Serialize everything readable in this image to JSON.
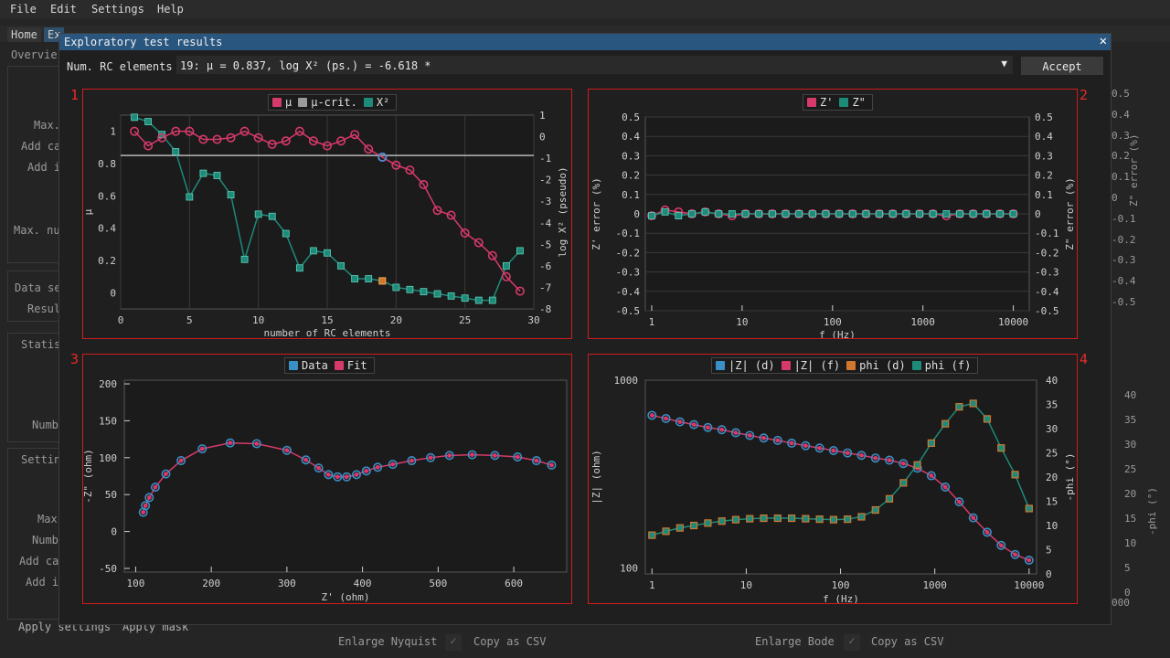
{
  "menu": [
    "File",
    "Edit",
    "Settings",
    "Help"
  ],
  "bg_tabs": [
    "Home",
    "Ex"
  ],
  "bg_left": {
    "overview": "Overvie",
    "max": "Max.",
    "add_ca": "Add ca",
    "add_i": "Add i",
    "max_nu": "Max. nu",
    "data_se": "Data se",
    "resul": "Resul",
    "statis": "Statis",
    "numb": "Numb",
    "settin": "Settin",
    "max2": "Max",
    "numb2": "Numb",
    "add_ca2": "Add ca",
    "add_i2": "Add i",
    "apply_settings": "Apply settings",
    "apply_mask": "Apply mask"
  },
  "bg_right_ticks": [
    "0.5",
    "0.4",
    "0.3",
    "0.2",
    "0.1",
    "0",
    "-0.1",
    "-0.2",
    "-0.3",
    "-0.4",
    "-0.5"
  ],
  "bg_right_label": "Z\" error (%)",
  "bg_right_ticks2": [
    "40",
    "35",
    "30",
    "25",
    "20",
    "15",
    "10",
    "5",
    "0"
  ],
  "bg_right_label2": "-phi (°)",
  "bg_right_bottom": "000",
  "bottom": {
    "enlarge_nyquist": "Enlarge Nyquist",
    "copy_csv_1": "Copy as CSV",
    "enlarge_bode": "Enlarge Bode",
    "copy_csv_2": "Copy as CSV",
    "check": "✓"
  },
  "modal": {
    "title": "Exploratory test results",
    "close": "✕",
    "rc_label": "Num. RC elements",
    "rc_value": "19: μ = 0.837, log X² (ps.) = -6.618 *",
    "arrow": "▼",
    "accept": "Accept"
  },
  "colors": {
    "mu": "#d63a6a",
    "crit": "#9a9a9a",
    "x2": "#1e8a7a",
    "data": "#3a8fc4",
    "fit": "#d63a6a",
    "phi_d": "#d0782e",
    "phi_f": "#1e8a7a",
    "highlight": "#4d8fd6",
    "frame": "#d01c1c"
  },
  "plots": [
    {
      "number": "1",
      "legend": [
        "μ",
        "μ-crit.",
        "X²"
      ],
      "chart_data": {
        "type": "line",
        "xlabel": "number of RC elements",
        "ylabel": "μ",
        "y2label": "log X² (pseudo)",
        "xlim": [
          0,
          30
        ],
        "ylim": [
          -0.1,
          1.1
        ],
        "y2lim": [
          -8,
          1
        ],
        "xticks": [
          "0",
          "5",
          "10",
          "15",
          "20",
          "25",
          "30"
        ],
        "yticks": [
          "0",
          "0.2",
          "0.4",
          "0.6",
          "0.8",
          "1"
        ],
        "y2ticks": [
          "1",
          "0",
          "-1",
          "-2",
          "-3",
          "-4",
          "-5",
          "-6",
          "-7",
          "-8"
        ],
        "mu_crit": 0.85,
        "selected": 19,
        "series": [
          {
            "name": "μ",
            "x": [
              1,
              2,
              3,
              4,
              5,
              6,
              7,
              8,
              9,
              10,
              11,
              12,
              13,
              14,
              15,
              16,
              17,
              18,
              19,
              20,
              21,
              22,
              23,
              24,
              25,
              26,
              27,
              28,
              29
            ],
            "values": [
              1.0,
              0.91,
              0.96,
              1.0,
              1.0,
              0.95,
              0.95,
              0.96,
              1.0,
              0.96,
              0.92,
              0.94,
              1.0,
              0.94,
              0.91,
              0.94,
              0.98,
              0.89,
              0.84,
              0.79,
              0.76,
              0.67,
              0.51,
              0.48,
              0.37,
              0.31,
              0.23,
              0.1,
              0.01
            ]
          },
          {
            "name": "X²",
            "x": [
              1,
              2,
              3,
              4,
              5,
              6,
              7,
              8,
              9,
              10,
              11,
              12,
              13,
              14,
              15,
              16,
              17,
              18,
              19,
              20,
              21,
              22,
              23,
              24,
              25,
              26,
              27,
              28,
              29
            ],
            "values": [
              0.9,
              0.7,
              0.1,
              -0.7,
              -2.8,
              -1.7,
              -1.8,
              -2.7,
              -5.7,
              -3.6,
              -3.7,
              -4.5,
              -6.1,
              -5.3,
              -5.4,
              -6.0,
              -6.6,
              -6.6,
              -6.7,
              -7.0,
              -7.1,
              -7.2,
              -7.3,
              -7.4,
              -7.5,
              -7.6,
              -7.6,
              -6.0,
              -5.3
            ]
          }
        ]
      }
    },
    {
      "number": "2",
      "legend": [
        "Z'",
        "Z\""
      ],
      "chart_data": {
        "type": "line",
        "xlabel": "f (Hz)",
        "ylabel": "Z' error (%)",
        "y2label": "Z\" error (%)",
        "xscale": "log",
        "xlim": [
          1,
          10000
        ],
        "ylim": [
          -0.5,
          0.5
        ],
        "xticks": [
          "1",
          "10",
          "100",
          "1000",
          "10000"
        ],
        "yticks": [
          "0.5",
          "0.4",
          "0.3",
          "0.2",
          "0.1",
          "0",
          "-0.1",
          "-0.2",
          "-0.3",
          "-0.4",
          "-0.5"
        ],
        "series": [
          {
            "name": "Z'",
            "values": [
              -0.01,
              0.02,
              0.01,
              0.0,
              0.01,
              0.0,
              -0.01,
              0.0,
              0.0,
              0.0,
              0.0,
              0.0,
              0.0,
              0.0,
              0.0,
              0.0,
              0.0,
              0.0,
              0.0,
              0.0,
              0.0,
              0.0,
              -0.01,
              0.0,
              0.0,
              0.0,
              0.0,
              0.0
            ]
          },
          {
            "name": "Z\"",
            "values": [
              -0.01,
              0.01,
              -0.01,
              0.0,
              0.01,
              0.0,
              0.0,
              0.0,
              0.0,
              0.0,
              0.0,
              0.0,
              0.0,
              0.0,
              0.0,
              0.0,
              0.0,
              0.0,
              0.0,
              0.0,
              0.0,
              0.0,
              0.0,
              0.0,
              0.0,
              0.0,
              0.0,
              0.0
            ]
          }
        ]
      }
    },
    {
      "number": "3",
      "legend": [
        "Data",
        "Fit"
      ],
      "chart_data": {
        "type": "scatter",
        "xlabel": "Z' (ohm)",
        "ylabel": "-Z\" (ohm)",
        "xlim": [
          85,
          670
        ],
        "ylim": [
          -55,
          205
        ],
        "xticks": [
          "100",
          "200",
          "300",
          "400",
          "500",
          "600"
        ],
        "yticks": [
          "200",
          "150",
          "100",
          "50",
          "0",
          "-50"
        ],
        "series": [
          {
            "name": "Data",
            "x": [
              110,
              113,
              118,
              126,
              140,
              160,
              188,
              225,
              260,
              300,
              325,
              342,
              355,
              367,
              379,
              392,
              405,
              420,
              440,
              465,
              490,
              515,
              545,
              575,
              605,
              630,
              650
            ],
            "values": [
              26,
              35,
              46,
              60,
              78,
              96,
              112,
              120,
              119,
              110,
              97,
              86,
              77,
              74,
              74,
              77,
              82,
              87,
              91,
              96,
              100,
              103,
              104,
              103,
              101,
              96,
              90
            ]
          }
        ]
      }
    },
    {
      "number": "4",
      "legend": [
        "|Z| (d)",
        "|Z| (f)",
        "phi (d)",
        "phi (f)"
      ],
      "chart_data": {
        "type": "line",
        "xlabel": "f (Hz)",
        "ylabel": "|Z| (ohm)",
        "y2label": "-phi (°)",
        "xscale": "log",
        "yscale": "log",
        "xlim": [
          0.85,
          12000
        ],
        "ylim": [
          93,
          1000
        ],
        "y2lim": [
          0,
          40
        ],
        "xticks": [
          "1",
          "10",
          "100",
          "1000",
          "10000"
        ],
        "yticks": [
          "1000",
          "100"
        ],
        "y2ticks": [
          "40",
          "35",
          "30",
          "25",
          "20",
          "15",
          "10",
          "5",
          "0"
        ],
        "series": [
          {
            "name": "|Z|",
            "values": [
              650,
              625,
              600,
              580,
              560,
              545,
              525,
              508,
              492,
              478,
              462,
              448,
              435,
              422,
              410,
              398,
              385,
              375,
              360,
              340,
              310,
              270,
              225,
              185,
              155,
              132,
              118,
              110
            ]
          },
          {
            "name": "phi",
            "values": [
              8,
              8.8,
              9.5,
              10,
              10.5,
              10.9,
              11.2,
              11.4,
              11.5,
              11.5,
              11.5,
              11.4,
              11.3,
              11.2,
              11.3,
              11.8,
              13.2,
              15.5,
              18.8,
              22.5,
              27,
              31,
              34.5,
              35.2,
              32,
              26,
              20.5,
              13.5
            ]
          }
        ]
      }
    }
  ]
}
